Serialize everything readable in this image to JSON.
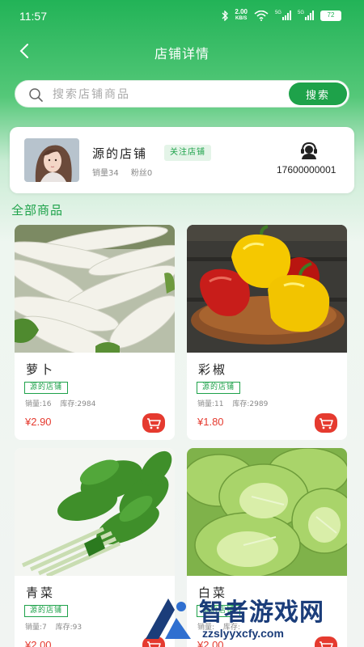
{
  "status_bar": {
    "time": "11:57",
    "net_speed_value": "2.00",
    "net_speed_unit": "KB/S",
    "sim1": "5G",
    "sim2": "5G",
    "battery": "72"
  },
  "nav": {
    "title": "店铺详情"
  },
  "search": {
    "placeholder": "搜索店铺商品",
    "button_label": "搜索"
  },
  "shop": {
    "name": "源的店铺",
    "follow_label": "关注店铺",
    "sales": "销量34",
    "fans": "粉丝0",
    "phone": "17600000001"
  },
  "section": {
    "title": "全部商品"
  },
  "products": [
    {
      "name": "萝卜",
      "shop_tag": "源的店铺",
      "sales": "销量:16",
      "stock": "库存:2984",
      "price": "¥2.90"
    },
    {
      "name": "彩椒",
      "shop_tag": "源的店铺",
      "sales": "销量:11",
      "stock": "库存:2989",
      "price": "¥1.80"
    },
    {
      "name": "青菜",
      "shop_tag": "源的店铺",
      "sales": "销量:7",
      "stock": "库存:93",
      "price": "¥2.00"
    },
    {
      "name": "白菜",
      "shop_tag": "源的店铺",
      "sales": "销量:",
      "stock": "库存:",
      "price": "¥2.00"
    }
  ],
  "watermark": {
    "text": "智者游戏网",
    "url": "zzslyyxcfy.com"
  },
  "colors": {
    "brand_green": "#1ea24a",
    "price_red": "#e53a2f",
    "header_green": "#22b357"
  }
}
